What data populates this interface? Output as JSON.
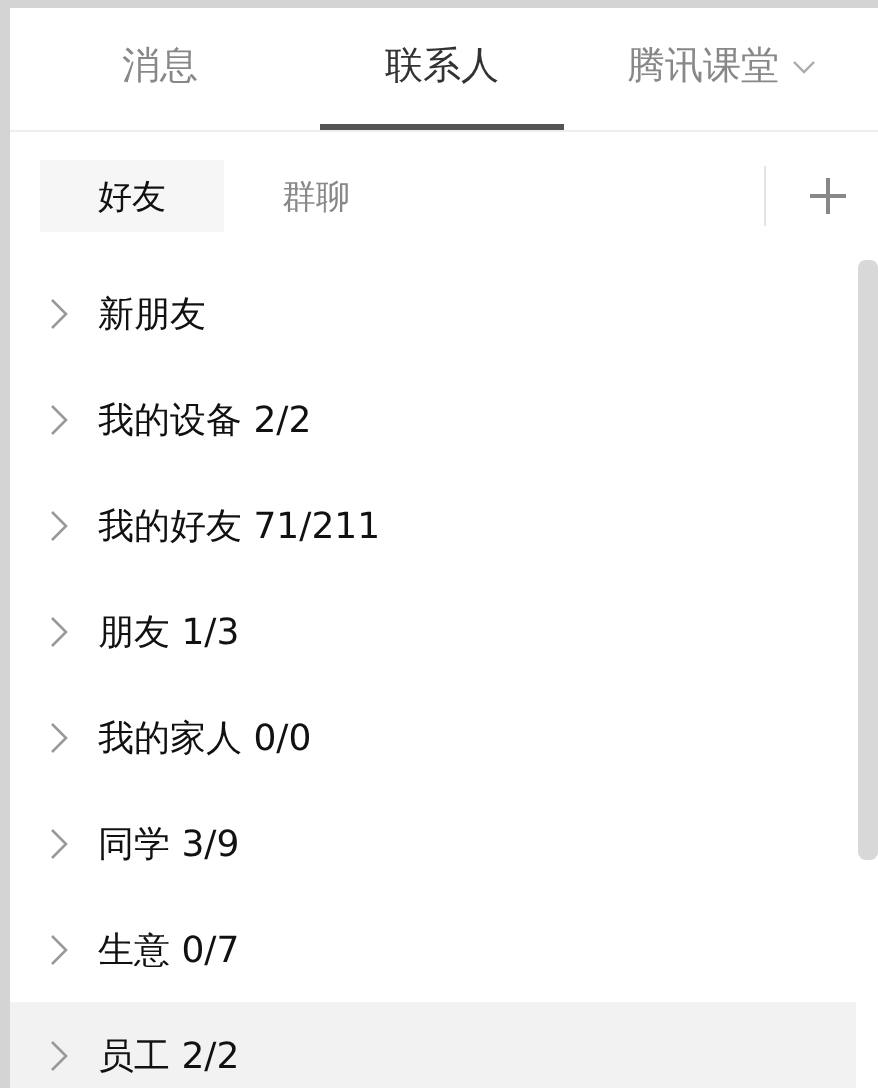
{
  "tabs": [
    {
      "label": "消息",
      "selected": false,
      "dropdown": false
    },
    {
      "label": "联系人",
      "selected": true,
      "dropdown": false
    },
    {
      "label": "腾讯课堂",
      "selected": false,
      "dropdown": true
    }
  ],
  "subtabs": [
    {
      "label": "好友",
      "selected": true
    },
    {
      "label": "群聊",
      "selected": false
    }
  ],
  "groups": [
    {
      "label": "新朋友",
      "selected": false
    },
    {
      "label": "我的设备 2/2",
      "selected": false
    },
    {
      "label": "我的好友 71/211",
      "selected": false
    },
    {
      "label": "朋友 1/3",
      "selected": false
    },
    {
      "label": "我的家人 0/0",
      "selected": false
    },
    {
      "label": "同学 3/9",
      "selected": false
    },
    {
      "label": "生意 0/7",
      "selected": false
    },
    {
      "label": "员工 2/2",
      "selected": true
    }
  ]
}
